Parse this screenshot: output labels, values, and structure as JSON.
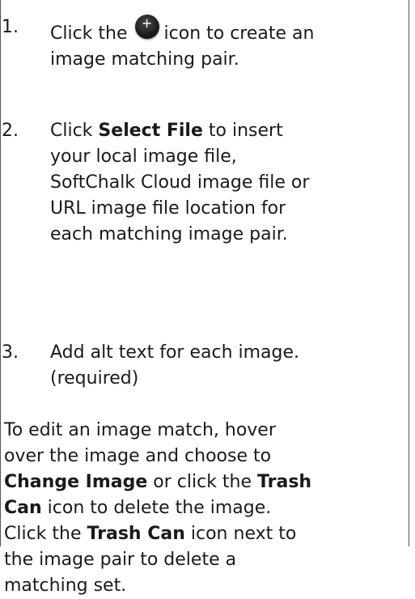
{
  "steps": [
    {
      "number": "1.",
      "pre": "Click the",
      "icon": "plus-circle-icon",
      "post": "icon to create an",
      "line2": "image matching pair."
    },
    {
      "number": "2.",
      "l1_pre": "Click",
      "l1_bold": "Select File",
      "l1_post": "to insert",
      "l2": "your local image file,",
      "l3": "SoftChalk Cloud image file or",
      "l4": "URL image file location for",
      "l5": "each matching image pair."
    },
    {
      "number": "3.",
      "l1": "Add alt text for each image.",
      "l2": "(required)"
    }
  ],
  "note": {
    "l1": "To edit an image match, hover",
    "l2": "over the image and choose to",
    "l3_bold1": "Change Image",
    "l3_mid": "or click the",
    "l3_bold2": "Trash",
    "l4_bold": "Can",
    "l4_rest": "icon to delete the image.",
    "l5_pre": "Click the",
    "l5_bold": "Trash Can",
    "l5_post": "icon next to",
    "l6": "the image pair to delete a",
    "l7": "matching set."
  }
}
